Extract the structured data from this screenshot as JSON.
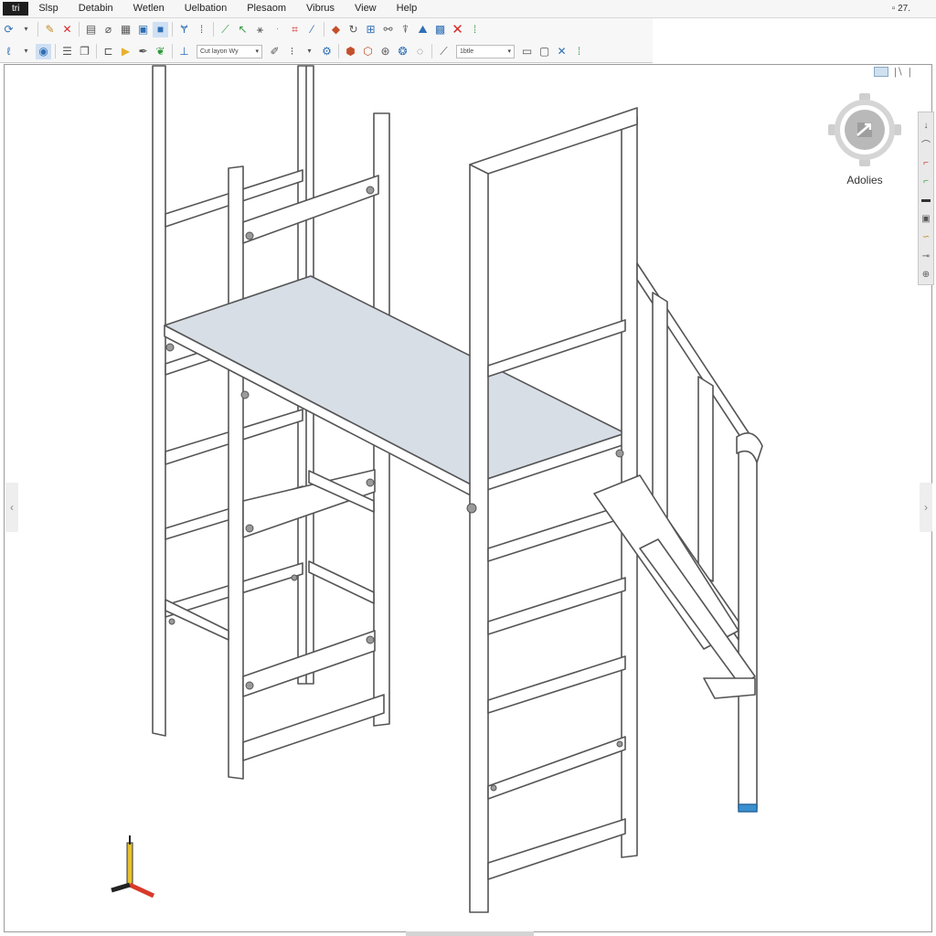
{
  "app": {
    "badge": "tri"
  },
  "menu": {
    "items": [
      "Slsp",
      "Detabin",
      "Wetlen",
      "Uelbation",
      "Plesaom",
      "Vibrus",
      "View",
      "Help"
    ],
    "status_right": "▫ 27."
  },
  "toolbar": {
    "row1_icons": [
      "refresh-icon",
      "dropdown-arrow-icon",
      "pencil-flag-icon",
      "delete-x-icon",
      "page-icon",
      "clip-icon",
      "grid-icon",
      "window-icon",
      "blue-select-icon",
      "branch-icon",
      "dots-icon",
      "measure-icon",
      "arrow-green-icon",
      "filter-icon",
      "dash-icon",
      "crop-icon",
      "plane-icon",
      "move-icon",
      "rotate-icon",
      "scale-icon",
      "link-icon",
      "funnel-icon",
      "graph-icon",
      "chart-icon",
      "close-red-icon"
    ],
    "row2_icons": [
      "lasso-icon",
      "camera-icon",
      "list-icon",
      "copy-icon",
      "snap-icon",
      "marker-icon",
      "leaf-icon",
      "layer-icon",
      "text-icon",
      "array-icon",
      "array2-icon",
      "gear-icon",
      "cube-icon",
      "cube2-icon",
      "target-icon",
      "line-icon",
      "frame-icon",
      "view-icon",
      "cross-icon",
      "expand-icon"
    ],
    "select_style": "Cut layon Wy",
    "select_view": "1btle",
    "color_red": "#d62a2a",
    "color_blue": "#2f6fb5",
    "color_green": "#2f9a3a"
  },
  "viewcube": {
    "label": "Adolies"
  },
  "nav_icons": [
    "pan-down-icon",
    "orbit-icon",
    "zoom-icon",
    "zoom-green-icon",
    "layer-dark-icon",
    "cube-icon",
    "walk-icon",
    "look-icon",
    "settings-icon"
  ],
  "scene": {
    "platform_color": "#d8dee6",
    "frame_color": "#ffffff",
    "line_color": "#555555",
    "foot_color": "#3b8fcf"
  },
  "ucs": {
    "x_color": "#d83a2a",
    "y_color": "#e7c22e",
    "z_color": "#222222"
  }
}
